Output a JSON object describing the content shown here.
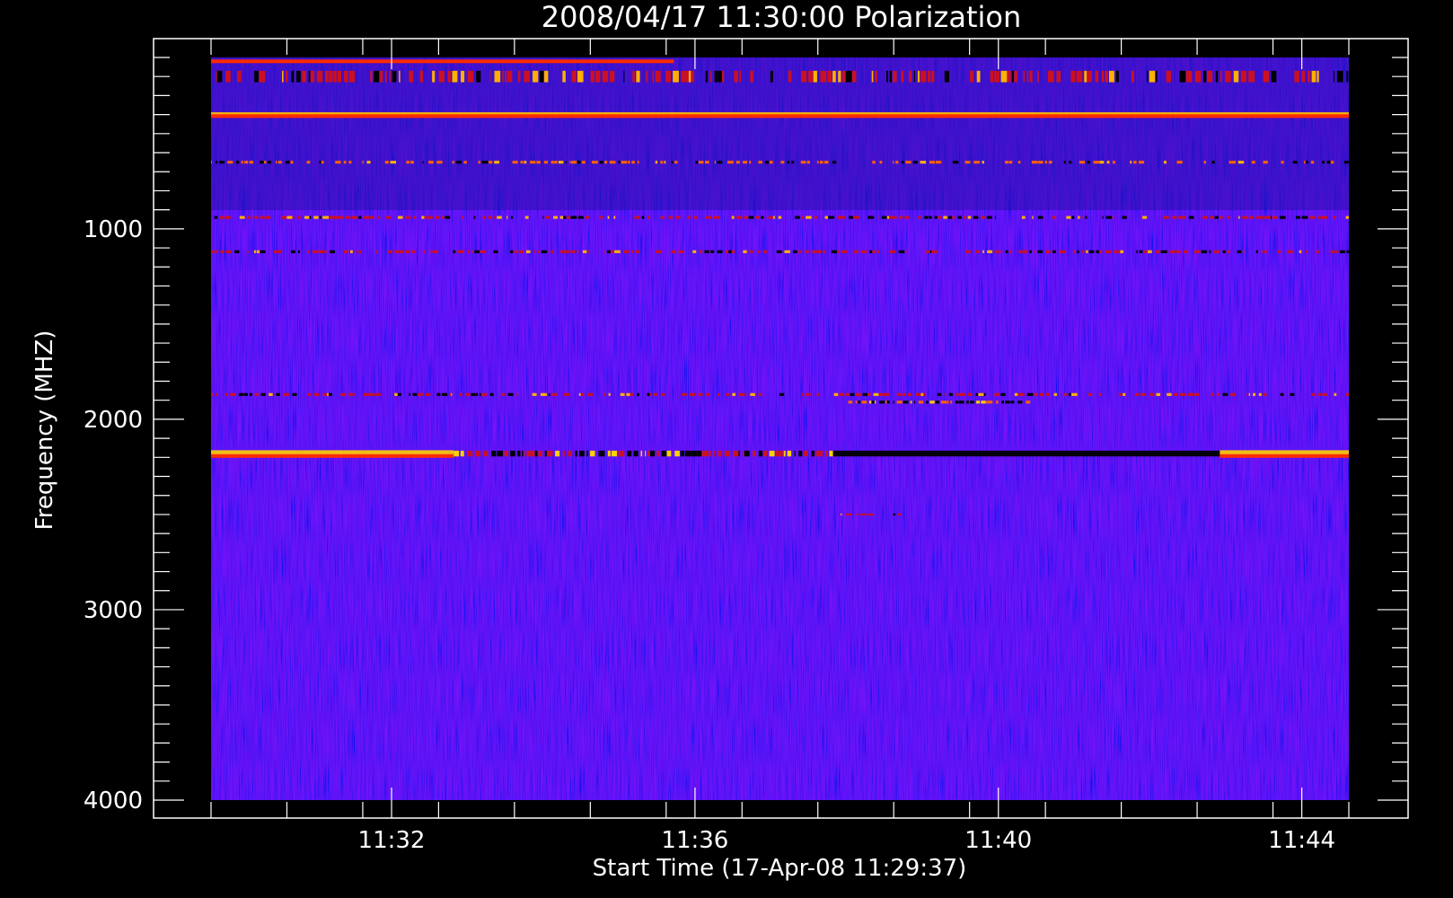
{
  "chart_data": {
    "type": "heatmap",
    "title": "2008/04/17 11:30:00 Polarization",
    "xlabel": "Start Time (17-Apr-08 11:29:37)",
    "ylabel": "Frequency (MHZ)",
    "x_tick_labels": [
      "11:32",
      "11:36",
      "11:40",
      "11:44"
    ],
    "y_tick_labels": [
      "1000",
      "2000",
      "3000",
      "4000"
    ],
    "x_ticks_minutes": [
      2.38,
      6.38,
      10.38,
      14.38
    ],
    "y_ticks_mhz": [
      1000,
      2000,
      3000,
      4000
    ],
    "xlim_minutes": [
      0,
      15
    ],
    "ylim_mhz": [
      100,
      4000
    ],
    "y_axis_inverted": true,
    "colormap": [
      "#000000",
      "#2a0c8a",
      "#1e1ee0",
      "#3030ff",
      "#cc1020",
      "#ff4a00",
      "#ffd000",
      "#ffffff"
    ],
    "background_level_color": "#2b2bf2",
    "bands": [
      {
        "freq_mhz": 120,
        "width_mhz": 10,
        "kind": "bright",
        "color": "#ffffff",
        "t_start": 0,
        "t_end": 6.1
      },
      {
        "freq_mhz": 200,
        "width_mhz": 60,
        "kind": "noisy",
        "color": "#cc1020",
        "t_start": 0,
        "t_end": 15
      },
      {
        "freq_mhz": 400,
        "width_mhz": 25,
        "kind": "bright",
        "color": "#ffc000",
        "t_start": 0,
        "t_end": 15
      },
      {
        "freq_mhz": 650,
        "width_mhz": 15,
        "kind": "noisy",
        "color": "#ff6000",
        "t_start": 0,
        "t_end": 15
      },
      {
        "freq_mhz": 940,
        "width_mhz": 15,
        "kind": "noisy",
        "color": "#cc1020",
        "t_start": 0,
        "t_end": 15
      },
      {
        "freq_mhz": 1120,
        "width_mhz": 15,
        "kind": "noisy",
        "color": "#cc1020",
        "t_start": 0,
        "t_end": 15
      },
      {
        "freq_mhz": 1870,
        "width_mhz": 15,
        "kind": "noisy",
        "color": "#cc1020",
        "t_start": 0,
        "t_end": 15
      },
      {
        "freq_mhz": 1910,
        "width_mhz": 15,
        "kind": "mixed",
        "color": "#ff6000",
        "t_start": 8.4,
        "t_end": 10.8
      },
      {
        "freq_mhz": 2180,
        "width_mhz": 35,
        "kind": "bright",
        "color": "#ffd000",
        "t_start": 0,
        "t_end": 3.2
      },
      {
        "freq_mhz": 2180,
        "width_mhz": 30,
        "kind": "mixed",
        "color": "#cc1020",
        "t_start": 3.2,
        "t_end": 8.2
      },
      {
        "freq_mhz": 2180,
        "width_mhz": 30,
        "kind": "dark",
        "color": "#000000",
        "t_start": 8.2,
        "t_end": 13.3
      },
      {
        "freq_mhz": 2180,
        "width_mhz": 35,
        "kind": "bright",
        "color": "#ffd000",
        "t_start": 13.3,
        "t_end": 15
      },
      {
        "freq_mhz": 2500,
        "width_mhz": 10,
        "kind": "noisy",
        "color": "#cc1020",
        "t_start": 8.3,
        "t_end": 9.1
      }
    ]
  }
}
